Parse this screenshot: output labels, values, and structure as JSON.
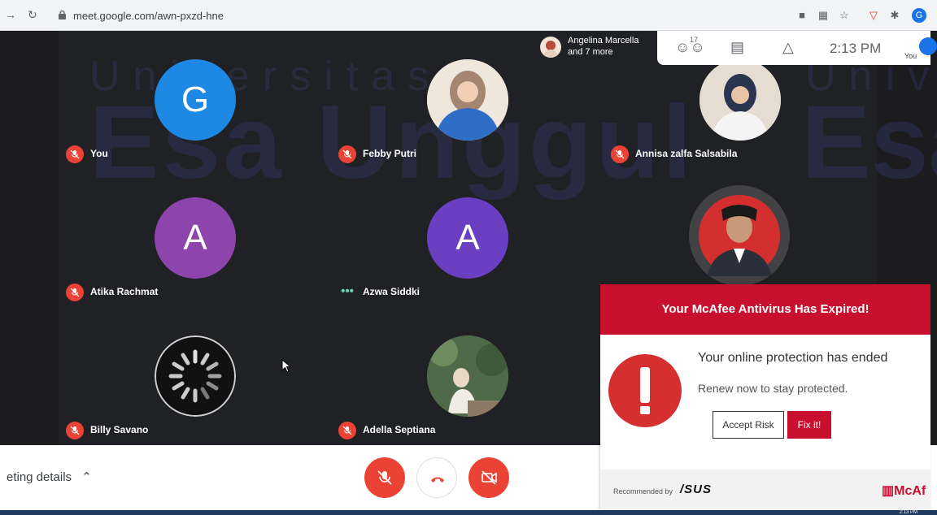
{
  "browser": {
    "url": "meet.google.com/awn-pxzd-hne",
    "profile_initial": "G"
  },
  "watermark": {
    "line1": "Universitas",
    "line2": "Esa Unggul",
    "right_line1": "Unive",
    "right_line2": "Esa"
  },
  "presenting": {
    "line1": "Angelina Marcella",
    "line2": "and 7 more"
  },
  "meet_toolbar": {
    "people_count": "17",
    "time": "2:13 PM",
    "you_label": "You"
  },
  "participants": [
    {
      "name": "You",
      "initial": "G",
      "color": "#1e88e5",
      "status": "muted"
    },
    {
      "name": "Febby Putri",
      "initial": "",
      "color": "#2f6ec7",
      "status": "muted"
    },
    {
      "name": "Annisa zalfa Salsabila",
      "initial": "",
      "color": "#e8e0d6",
      "status": "muted"
    },
    {
      "name": "Atika Rachmat",
      "initial": "A",
      "color": "#8e44ad",
      "status": "muted"
    },
    {
      "name": "Azwa Siddki",
      "initial": "A",
      "color": "#6a3fc1",
      "status": "speaking"
    },
    {
      "name": "",
      "initial": "",
      "color": "#d32f2f",
      "status": "none"
    },
    {
      "name": "Billy Savano",
      "initial": "",
      "color": "#111111",
      "status": "muted"
    },
    {
      "name": "Adella Septiana",
      "initial": "",
      "color": "#5f7a54",
      "status": "muted"
    }
  ],
  "bottom_bar": {
    "meeting_details": "eting details"
  },
  "mcafee": {
    "title": "Your McAfee Antivirus Has Expired!",
    "heading": "Your online protection has ended",
    "subtext": "Renew now to stay protected.",
    "accept_label": "Accept Risk",
    "fix_label": "Fix it!",
    "recommended": "Recommended by",
    "asus": "/SUS",
    "brand": "McAf"
  },
  "taskbar": {
    "clock": "2:13 PM"
  }
}
